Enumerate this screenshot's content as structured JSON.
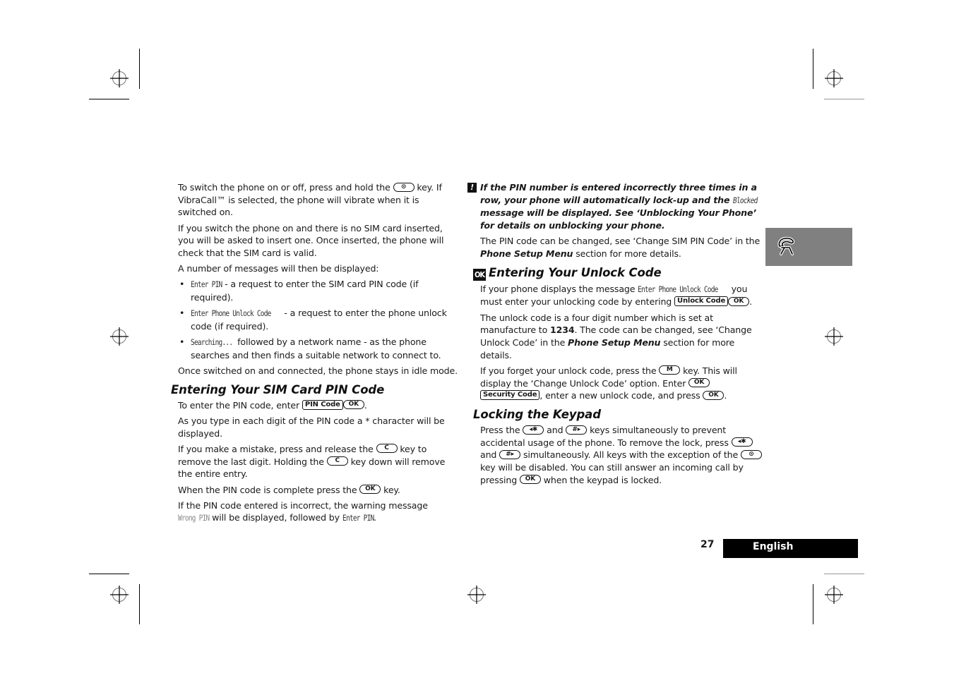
{
  "page": {
    "number": "27",
    "language_tab": "English",
    "side_tab_icon": "phone-handset-icon"
  },
  "left_column": {
    "intro": [
      [
        "To switch the phone on or off, press and hold the ",
        "{power}",
        " key. If VibraCall™ is selected, the phone will vibrate when it is switched on."
      ],
      "If you switch the phone on and there is no SIM card inserted, you will be asked to insert one. Once inserted, the phone will check that the SIM card is valid.",
      "A number of messages will then be displayed:"
    ],
    "bullets": [
      {
        "display": "Enter PIN",
        "text": " - a request to enter the SIM card PIN code (if required)."
      },
      {
        "display": "Enter Phone Unlock Code",
        "text": " - a request to enter the phone unlock code (if required)."
      },
      {
        "display": "Searching...",
        "text": " followed by a network name - as the phone searches and then finds a suitable network to connect to."
      }
    ],
    "after_bullets": "Once switched on and connected, the phone stays in idle mode.",
    "section_pin": {
      "heading": "Entering Your SIM Card PIN Code",
      "p1_pre": "To enter the PIN code, enter ",
      "p1_key": "PIN Code",
      "p1_ok": "OK",
      "p1_post": ".",
      "p2_pre": "As you type in each digit of the PIN code a ",
      "p2_char": "*",
      "p2_post": " character will be displayed.",
      "p3_a": "If you make a mistake, press and release the ",
      "p3_key": "C",
      "p3_b": " key to remove the last digit. Holding the ",
      "p3_c": " key down will remove the entire entry.",
      "p4_pre": "When the PIN code is complete press the ",
      "p4_key": "OK",
      "p4_post": " key.",
      "p5_pre": "If the PIN code entered is incorrect, the warning message ",
      "p5_disp1": "Wrong PIN",
      "p5_mid": " will be displayed, followed by ",
      "p5_disp2": "Enter PIN",
      "p5_post": "."
    }
  },
  "right_column": {
    "note": {
      "icon": "warning-exclamation-icon",
      "pre": "If the PIN number is entered incorrectly three times in a row, your phone will automatically lock-up and the ",
      "display": "Blocked",
      "post": " message will be displayed. See ‘Unblocking Your Phone’ for details on unblocking your phone."
    },
    "pin_change_pre": "The PIN code can be changed, see ‘Change SIM PIN Code’ in the ",
    "pin_change_menu": "Phone Setup Menu",
    "pin_change_post": " section for more details.",
    "section_unlock": {
      "icon_label": "OK",
      "heading": "Entering Your Unlock Code",
      "p1_pre": "If your phone displays the message ",
      "p1_disp": "Enter Phone Unlock Code",
      "p1_mid": " you must enter your unlocking code by entering ",
      "p1_key": "Unlock Code",
      "p1_ok": "OK",
      "p1_post": ".",
      "p2_pre": "The unlock code is a four digit number which is set at manufacture to ",
      "p2_code": "1234",
      "p2_mid": ". The code can be changed, see ‘Change Unlock Code’ in the ",
      "p2_menu": "Phone Setup Menu",
      "p2_post": " section for more details.",
      "p3_pre": "If you forget your unlock code, press the ",
      "p3_key": "M",
      "p3_mid": " key. This will display the ‘Change Unlock Code’ option. Enter ",
      "p3_ok": "OK",
      "p3_skey": "Security Code",
      "p3_mid2": ", enter a new unlock code, and press ",
      "p3_post": "."
    },
    "section_keypad": {
      "heading": "Locking the Keypad",
      "a": "Press the ",
      "star_key": "◂✱",
      "b": " and ",
      "hash_key": "#▸",
      "c": " keys simultaneously to prevent accidental usage of the phone. To remove the lock, press ",
      "d": " and ",
      "e": " simultaneously. All keys with the exception of the ",
      "power_key": "⊙",
      "f": " key will be disabled. You can still answer an incoming call by pressing ",
      "ok_key": "OK",
      "g": " when the keypad is locked."
    }
  },
  "keys": {
    "power": "⊙"
  }
}
